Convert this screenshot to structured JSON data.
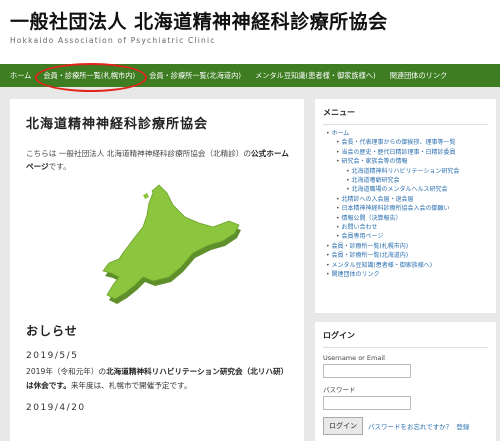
{
  "header": {
    "title": "一般社団法人 北海道精神神経科診療所協会",
    "subtitle": "Hokkaido Association of Psychiatric Clinic"
  },
  "nav": {
    "items": [
      {
        "label": "ホーム"
      },
      {
        "label": "会員・診療所一覧(札幌市内)"
      },
      {
        "label": "会員・診療所一覧(北海道内)"
      },
      {
        "label": "メンタル豆知識(患者様・御家族様へ)"
      },
      {
        "label": "関連団体のリンク"
      }
    ],
    "highlight_color": "#e2231a"
  },
  "main": {
    "title": "北海道精神神経科診療所協会",
    "intro_prefix": "こちらは 一般社団法人 北海道精神神経科診療所協会（北精診）の",
    "intro_bold": "公式ホームページ",
    "intro_suffix": "です。",
    "map_label": "hokkaido-map-icon",
    "news_heading": "おしらせ",
    "news": [
      {
        "date": "2019/5/5",
        "text_prefix": "2019年（令和元年）の",
        "text_bold": "北海道精神科リハビリテーション研究会（北リハ研）は休会です。",
        "text_suffix": "来年度は、札幌市で開催予定です。"
      },
      {
        "date": "2019/4/20"
      }
    ]
  },
  "sidebar": {
    "menu_title": "メニュー",
    "menu_items": [
      {
        "label": "ホーム",
        "level": 1
      },
      {
        "label": "会長・代表理事からの御挨拶、理事等一覧",
        "level": 2
      },
      {
        "label": "当会の歴史・歴代日精診理事・日精診委員",
        "level": 2
      },
      {
        "label": "研究会・家族会等の情報",
        "level": 2
      },
      {
        "label": "北海道精神科リハビリテーション研究会",
        "level": 3
      },
      {
        "label": "北海道嗜癖研究会",
        "level": 3
      },
      {
        "label": "北海道職場のメンタルヘルス研究会",
        "level": 3
      },
      {
        "label": "北精診への入会届・退会届",
        "level": 2
      },
      {
        "label": "日本精神神経科診療所協会入会の御願い",
        "level": 2
      },
      {
        "label": "情報公開（決算報告）",
        "level": 2
      },
      {
        "label": "お問い合わせ",
        "level": 2
      },
      {
        "label": "会員専用ページ",
        "level": 2
      },
      {
        "label": "会員・診療所一覧(札幌市内)",
        "level": 1
      },
      {
        "label": "会員・診療所一覧(北海道内)",
        "level": 1
      },
      {
        "label": "メンタル豆知識(患者様・御家族様へ)",
        "level": 1
      },
      {
        "label": "関連団体のリンク",
        "level": 1
      }
    ],
    "login": {
      "title": "ログイン",
      "username_label": "Username or Email",
      "password_label": "パスワード",
      "button_label": "ログイン",
      "forgot_label": "パスワードをお忘れですか？",
      "register_label": "登録"
    }
  },
  "colors": {
    "nav_bg": "#3e7d22",
    "map_green": "#8cc63f",
    "link": "#2a6fb0"
  }
}
